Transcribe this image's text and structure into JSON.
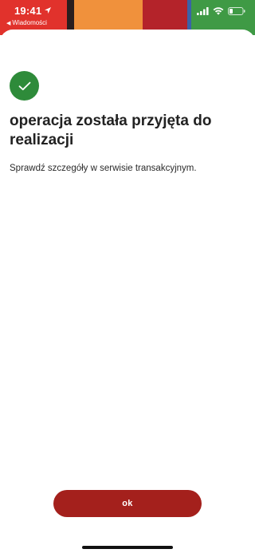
{
  "status_bar": {
    "time": "19:41",
    "back_app_label": "Wiadomości",
    "icons": [
      "location-arrow-icon",
      "signal-icon",
      "wifi-icon",
      "battery-icon"
    ]
  },
  "confirmation": {
    "icon": "checkmark-icon",
    "title": "operacja została przyjęta do realizacji",
    "message": "Sprawdź szczegóły w serwisie transakcyjnym."
  },
  "actions": {
    "ok_label": "ok"
  },
  "colors": {
    "success": "#2e8b3a",
    "primary_button": "#a4201c",
    "text": "#222222"
  }
}
